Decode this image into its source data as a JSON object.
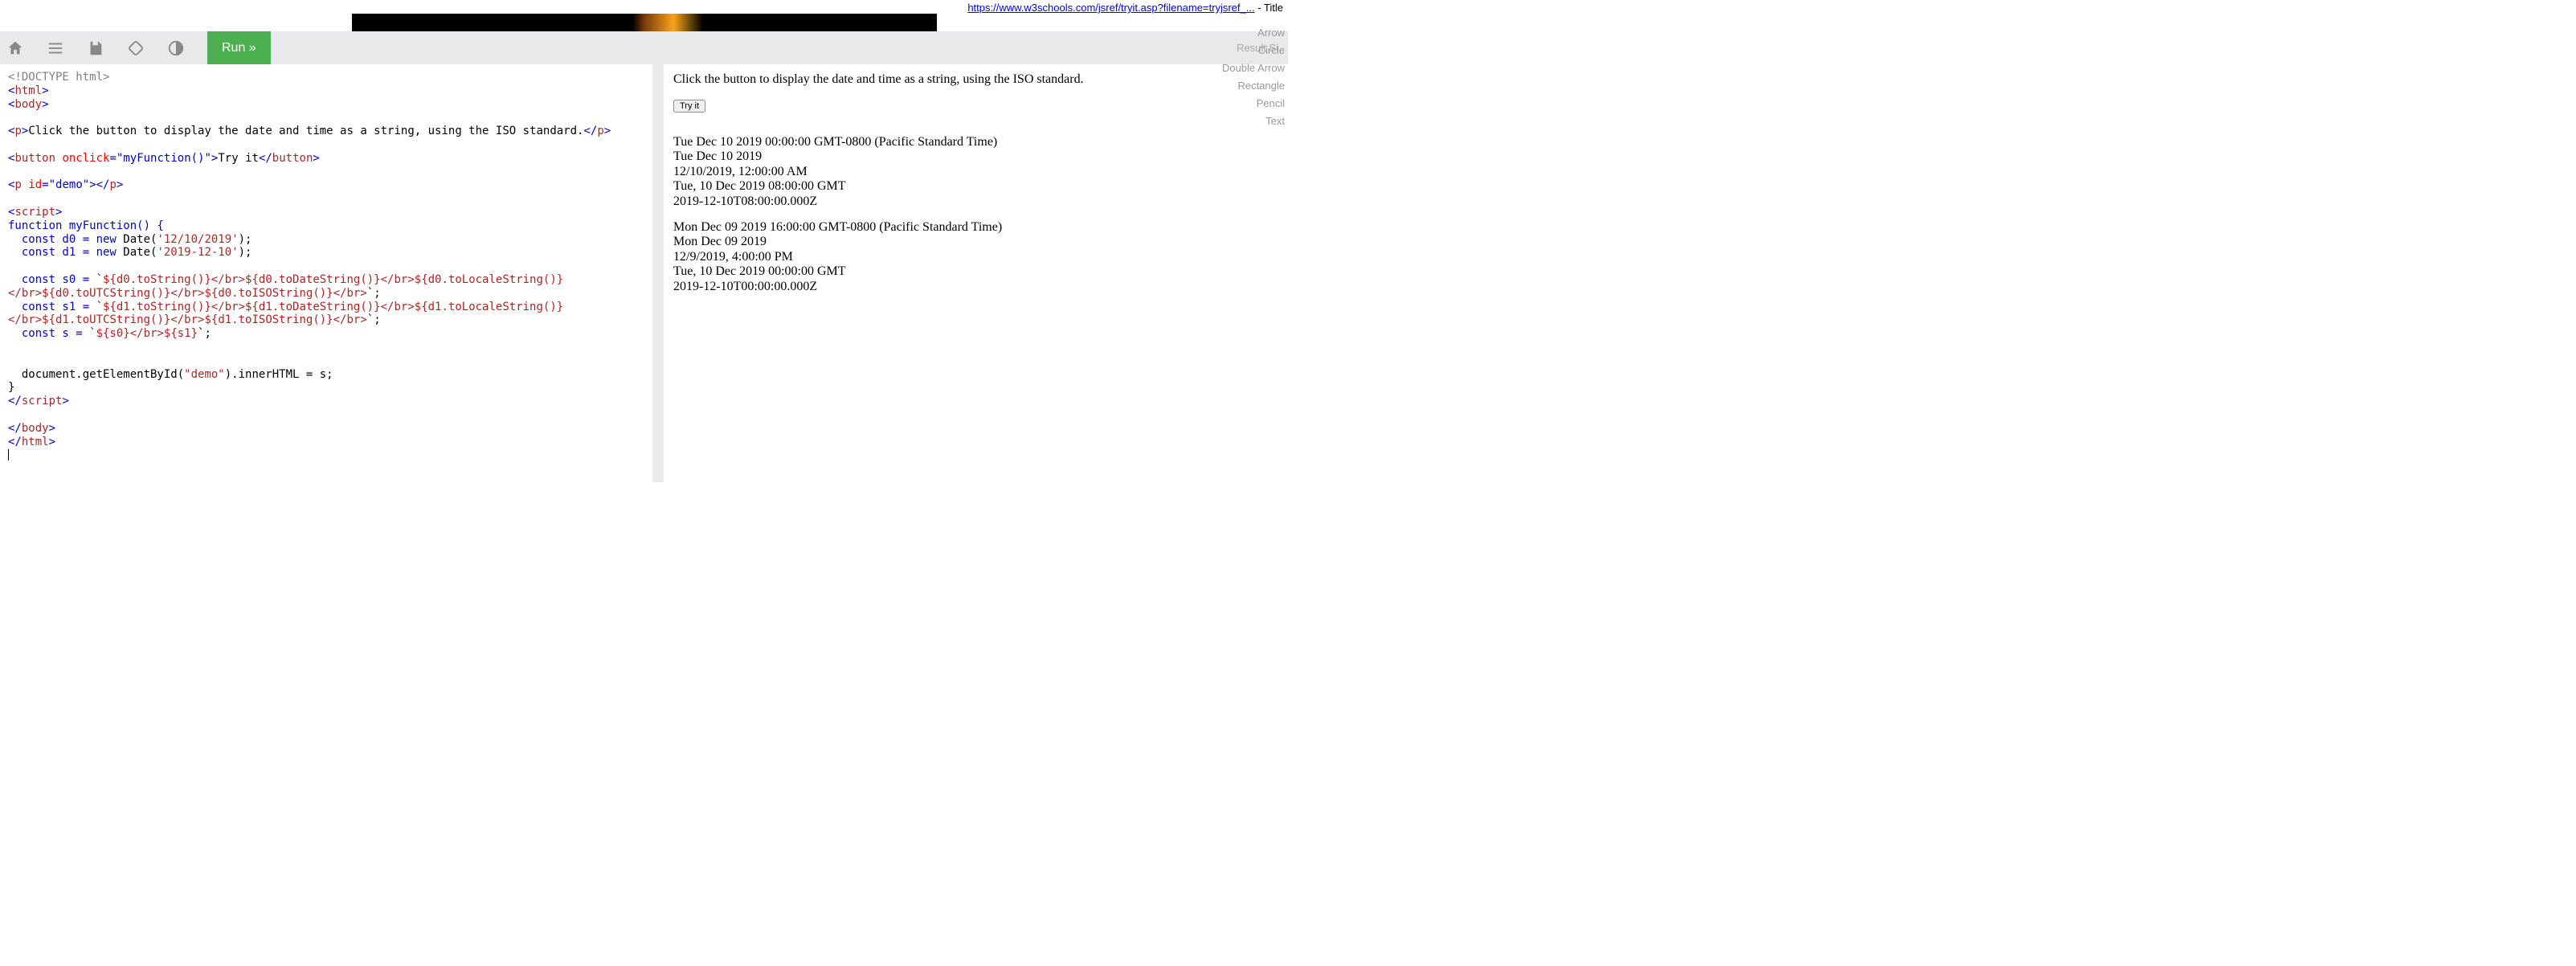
{
  "top_link": {
    "url_text": "https://www.w3schools.com/jsref/tryit.asp?filename=tryjsref_...",
    "suffix": " - Title"
  },
  "toolbar": {
    "run_label": "Run »",
    "result_size_label": "Result Si"
  },
  "annotations": {
    "items": [
      "Arrow",
      "Circle",
      "Double Arrow",
      "Rectangle",
      "Pencil",
      "Text"
    ]
  },
  "code": {
    "doctype": "<!DOCTYPE html>",
    "html_open": "html",
    "body_open": "body",
    "p_text": "Click the button to display the date and time as a string, using the ISO standard.",
    "button_attr": "onclick",
    "button_val": "\"myFunction()\"",
    "button_text": "Try it",
    "p2_attr": "id",
    "p2_val": "\"demo\"",
    "script_tag": "script",
    "fn_decl": "function myFunction() {",
    "c_d0a": "  const d0 = ",
    "c_new0": "new",
    "c_date0": " Date(",
    "c_str0": "'12/10/2019'",
    "c_close0": ");",
    "c_d1a": "  const d1 = ",
    "c_new1": "new",
    "c_date1": " Date(",
    "c_str1": "'2019-12-10'",
    "c_close1": ");",
    "s0_pre": "  const s0 = `",
    "s0_e1": "${d0.toString()}",
    "s0_e2": "${d0.toDateString()}",
    "s0_e3": "${d0.toLocaleString()}",
    "s0l2_e1": "${d0.toUTCString()}",
    "s0l2_e2": "${d0.toISOString()}",
    "s1_pre": "  const s1 = `",
    "s1_e1": "${d1.toString()}",
    "s1_e2": "${d1.toDateString()}",
    "s1_e3": "${d1.toLocaleString()}",
    "s1l2_e1": "${d1.toUTCString()}",
    "s1l2_e2": "${d1.toISOString()}",
    "br": "</br>",
    "tick_semi": "`;",
    "s_pre": "  const s = `",
    "s_e1": "${s0}",
    "s_e2": "${s1}",
    "assign": "  document.getElementById(",
    "demo_str": "\"demo\"",
    "assign2": ").innerHTML = s;",
    "fn_close": "}",
    "script_close": "script",
    "body_close": "body",
    "html_close": "html"
  },
  "result": {
    "intro": "Click the button to display the date and time as a string, using the ISO standard.",
    "tryit": "Try it",
    "block1": [
      "Tue Dec 10 2019 00:00:00 GMT-0800 (Pacific Standard Time)",
      "Tue Dec 10 2019",
      "12/10/2019, 12:00:00 AM",
      "Tue, 10 Dec 2019 08:00:00 GMT",
      "2019-12-10T08:00:00.000Z"
    ],
    "block2": [
      "Mon Dec 09 2019 16:00:00 GMT-0800 (Pacific Standard Time)",
      "Mon Dec 09 2019",
      "12/9/2019, 4:00:00 PM",
      "Tue, 10 Dec 2019 00:00:00 GMT",
      "2019-12-10T00:00:00.000Z"
    ]
  }
}
